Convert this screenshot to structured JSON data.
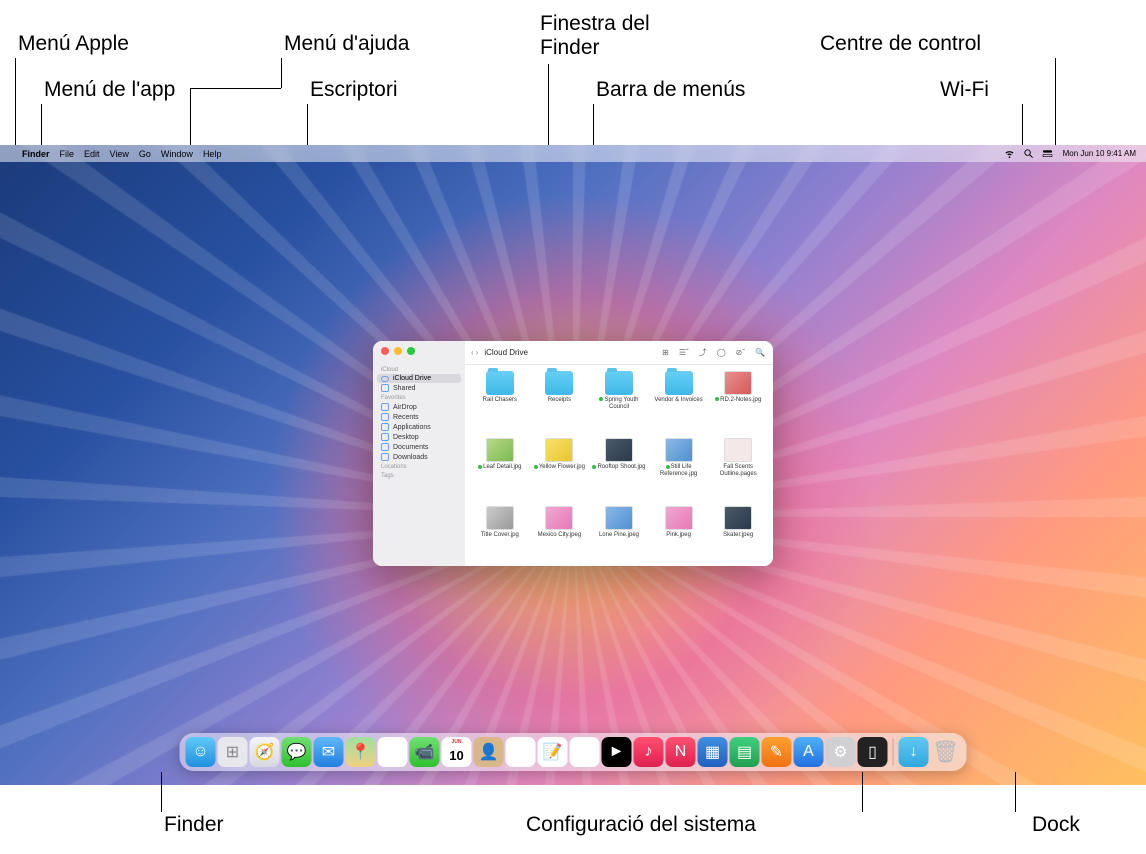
{
  "callouts": {
    "apple_menu": "Menú Apple",
    "app_menu": "Menú de l'app",
    "help_menu": "Menú d'ajuda",
    "desktop": "Escriptori",
    "finder_window": "Finestra del\nFinder",
    "menu_bar": "Barra de menús",
    "control_center": "Centre de control",
    "wifi": "Wi-Fi",
    "finder": "Finder",
    "system_settings": "Configuració del sistema",
    "dock": "Dock"
  },
  "menubar": {
    "app_name": "Finder",
    "items": [
      "File",
      "Edit",
      "View",
      "Go",
      "Window",
      "Help"
    ],
    "datetime": "Mon Jun 10  9:41 AM"
  },
  "finder": {
    "title": "iCloud Drive",
    "sidebar": {
      "sections": [
        {
          "label": "iCloud",
          "items": [
            {
              "label": "iCloud Drive",
              "icon": "cloud",
              "selected": true
            },
            {
              "label": "Shared",
              "icon": "shared"
            }
          ]
        },
        {
          "label": "Favorites",
          "items": [
            {
              "label": "AirDrop",
              "icon": "airdrop"
            },
            {
              "label": "Recents",
              "icon": "recents"
            },
            {
              "label": "Applications",
              "icon": "apps"
            },
            {
              "label": "Desktop",
              "icon": "desktop"
            },
            {
              "label": "Documents",
              "icon": "documents"
            },
            {
              "label": "Downloads",
              "icon": "downloads"
            }
          ]
        },
        {
          "label": "Locations",
          "items": []
        },
        {
          "label": "Tags",
          "items": []
        }
      ]
    },
    "files": [
      {
        "name": "Rail Chasers",
        "type": "folder"
      },
      {
        "name": "Receipts",
        "type": "folder"
      },
      {
        "name": "Spring Youth Council",
        "type": "folder",
        "synced": true
      },
      {
        "name": "Vendor & Invoices",
        "type": "folder"
      },
      {
        "name": "RD.2-Notes.jpg",
        "type": "image",
        "thumb": "red",
        "synced": true
      },
      {
        "name": "Leaf Detail.jpg",
        "type": "image",
        "thumb": "green",
        "synced": true
      },
      {
        "name": "Yellow Flower.jpg",
        "type": "image",
        "thumb": "yellow",
        "synced": true
      },
      {
        "name": "Rooftop Shoot.jpg",
        "type": "image",
        "thumb": "dark",
        "synced": true
      },
      {
        "name": "Still Life Reference.jpg",
        "type": "image",
        "thumb": "blue",
        "synced": true
      },
      {
        "name": "Fall Scents Outline.pages",
        "type": "image",
        "thumb": "white"
      },
      {
        "name": "Title Cover.jpg",
        "type": "image",
        "thumb": "gray"
      },
      {
        "name": "Mexico City.jpeg",
        "type": "image",
        "thumb": "pink"
      },
      {
        "name": "Lone Pine.jpeg",
        "type": "image",
        "thumb": "blue"
      },
      {
        "name": "Pink.jpeg",
        "type": "image",
        "thumb": "pink"
      },
      {
        "name": "Skater.jpeg",
        "type": "image",
        "thumb": "dark"
      }
    ]
  },
  "dock": {
    "apps": [
      {
        "name": "Finder",
        "bg": "linear-gradient(#60c8f8,#2090e0)",
        "glyph": "☺"
      },
      {
        "name": "Launchpad",
        "bg": "#e8e8ec",
        "glyph": "⊞"
      },
      {
        "name": "Safari",
        "bg": "linear-gradient(#f5f5f8,#d8d8e0)",
        "glyph": "🧭"
      },
      {
        "name": "Messages",
        "bg": "linear-gradient(#70e070,#30c030)",
        "glyph": "💬"
      },
      {
        "name": "Mail",
        "bg": "linear-gradient(#60b8f8,#2080e0)",
        "glyph": "✉"
      },
      {
        "name": "Maps",
        "bg": "linear-gradient(#a0e0a0,#f0d080)",
        "glyph": "📍"
      },
      {
        "name": "Photos",
        "bg": "#fff",
        "glyph": "✿"
      },
      {
        "name": "FaceTime",
        "bg": "linear-gradient(#70e070,#30c030)",
        "glyph": "📹"
      },
      {
        "name": "Calendar",
        "bg": "#fff",
        "glyph": "10"
      },
      {
        "name": "Contacts",
        "bg": "#d8b888",
        "glyph": "👤"
      },
      {
        "name": "Reminders",
        "bg": "#fff",
        "glyph": "☰"
      },
      {
        "name": "Notes",
        "bg": "#fff",
        "glyph": "📝"
      },
      {
        "name": "Freeform",
        "bg": "#fff",
        "glyph": "〰"
      },
      {
        "name": "TV",
        "bg": "#000",
        "glyph": "►"
      },
      {
        "name": "Music",
        "bg": "linear-gradient(#ff5070,#e02050)",
        "glyph": "♪"
      },
      {
        "name": "News",
        "bg": "linear-gradient(#ff5070,#e02050)",
        "glyph": "N"
      },
      {
        "name": "Keynote",
        "bg": "linear-gradient(#4090e0,#2060c0)",
        "glyph": "▦"
      },
      {
        "name": "Numbers",
        "bg": "linear-gradient(#40d080,#20a050)",
        "glyph": "▤"
      },
      {
        "name": "Pages",
        "bg": "linear-gradient(#ffa030,#f07010)",
        "glyph": "✎"
      },
      {
        "name": "App Store",
        "bg": "linear-gradient(#50b0f8,#2070e0)",
        "glyph": "A"
      },
      {
        "name": "System Settings",
        "bg": "#d0d0d4",
        "glyph": "⚙"
      },
      {
        "name": "iPhone Mirroring",
        "bg": "#222",
        "glyph": "▯"
      }
    ],
    "extras": [
      {
        "name": "Downloads",
        "bg": "linear-gradient(#60c8f0,#30a8e0)",
        "glyph": "↓"
      },
      {
        "name": "Trash",
        "bg": "transparent",
        "glyph": "🗑"
      }
    ]
  }
}
